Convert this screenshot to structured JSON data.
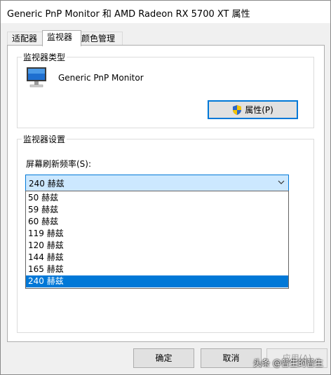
{
  "window": {
    "title": "Generic PnP Monitor 和 AMD Radeon RX 5700 XT 属性"
  },
  "tabs": [
    {
      "label": "适配器"
    },
    {
      "label": "监视器"
    },
    {
      "label": "颜色管理"
    }
  ],
  "monitor_type": {
    "group_label": "监视器类型",
    "monitor_name": "Generic PnP Monitor",
    "properties_button": "属性(P)",
    "icon": "monitor-icon"
  },
  "monitor_settings": {
    "group_label": "监视器设置",
    "refresh_label": "屏幕刷新频率(S):",
    "selected": "240 赫兹",
    "options": [
      "50 赫兹",
      "59 赫兹",
      "60 赫兹",
      "119 赫兹",
      "120 赫兹",
      "144 赫兹",
      "165 赫兹",
      "240 赫兹"
    ]
  },
  "footer": {
    "ok": "确定",
    "cancel": "取消",
    "apply": "应用(A)"
  },
  "watermark": "头条 @普生的普生",
  "colors": {
    "accent": "#0078d7",
    "selection_bg": "#cce8ff"
  }
}
